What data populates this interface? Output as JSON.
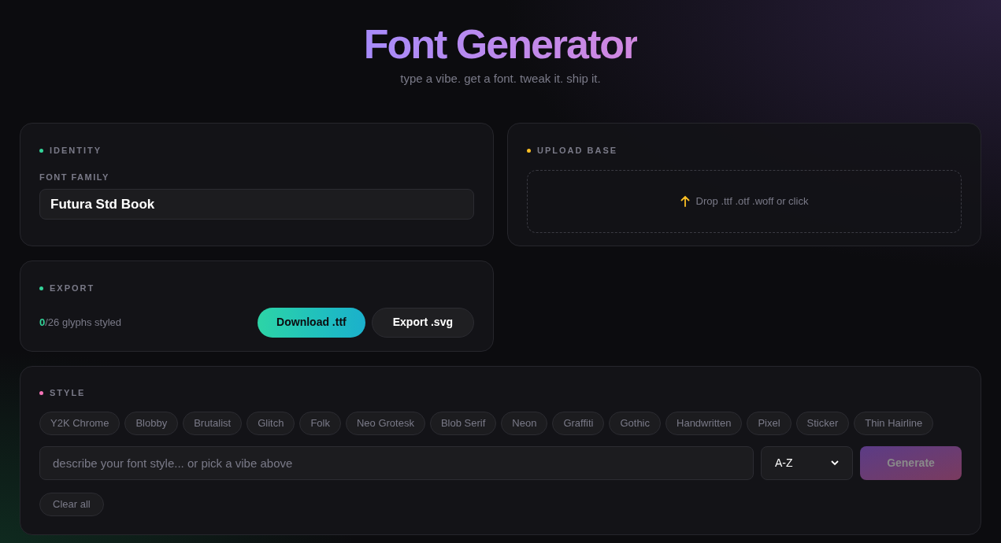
{
  "header": {
    "title": "Font Generator",
    "subtitle": "type a vibe. get a font. tweak it. ship it."
  },
  "identity": {
    "heading": "IDENTITY",
    "color": "#34d399",
    "field_label": "FONT FAMILY",
    "value": "Futura Std Book"
  },
  "upload": {
    "heading": "UPLOAD BASE",
    "color": "#fbbf24",
    "drop_text": "Drop .ttf .otf .woff or click"
  },
  "export": {
    "heading": "EXPORT",
    "color": "#34d399",
    "count": "0",
    "count_rest": "/26 glyphs styled",
    "buttons": [
      {
        "label": "Download .ttf",
        "kind": "primary"
      },
      {
        "label": "Export .svg",
        "kind": "secondary"
      }
    ]
  },
  "style": {
    "heading": "STYLE",
    "color": "#f472b6",
    "chips": [
      {
        "label": "Y2K Chrome",
        "selected": false
      },
      {
        "label": "Blobby",
        "selected": false
      },
      {
        "label": "Brutalist",
        "selected": false
      },
      {
        "label": "Glitch",
        "selected": false
      },
      {
        "label": "Folk",
        "selected": false
      },
      {
        "label": "Neo Grotesk",
        "selected": false
      },
      {
        "label": "Blob Serif",
        "selected": false
      },
      {
        "label": "Neon",
        "selected": false
      },
      {
        "label": "Graffiti",
        "selected": false
      },
      {
        "label": "Gothic",
        "selected": false
      },
      {
        "label": "Handwritten",
        "selected": false
      },
      {
        "label": "Pixel",
        "selected": false
      },
      {
        "label": "Sticker",
        "selected": false
      },
      {
        "label": "Thin Hairline",
        "selected": false
      }
    ],
    "prompt": {
      "placeholder": "describe your font style... or pick a vibe above"
    },
    "range": {
      "value": "A-Z"
    },
    "generate": {
      "label": "Generate",
      "disabled": true
    },
    "clear": {
      "label": "Clear all"
    }
  }
}
